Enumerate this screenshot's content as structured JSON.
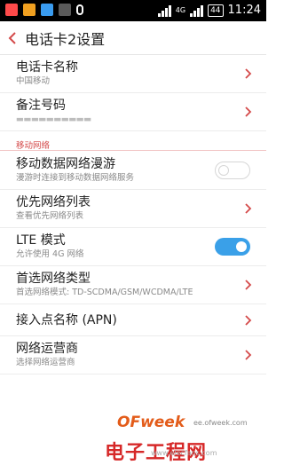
{
  "statusbar": {
    "network_label": "4G",
    "battery": "44",
    "time": "11:24"
  },
  "header": {
    "title": "电话卡2设置"
  },
  "rows": [
    {
      "main": "电话卡名称",
      "sub": "中国移动"
    },
    {
      "main": "备注号码",
      "sub": "▬▬▬▬▬▬▬▬▬▬"
    }
  ],
  "section": {
    "label": "移动网络"
  },
  "network_rows": [
    {
      "main": "移动数据网络漫游",
      "sub": "漫游时连接到移动数据网络服务",
      "toggle": "off"
    },
    {
      "main": "优先网络列表",
      "sub": "查看优先网络列表"
    },
    {
      "main": "LTE 模式",
      "sub": "允许使用 4G 网络",
      "toggle": "on"
    },
    {
      "main": "首选网络类型",
      "sub": "首选网络模式: TD-SCDMA/GSM/WCDMA/LTE"
    },
    {
      "main": "接入点名称 (APN)"
    },
    {
      "main": "网络运营商",
      "sub": "选择网络运营商"
    }
  ],
  "watermark": {
    "logo": "OFweek",
    "domain": "ee.ofweek.com",
    "big": "电子工程网",
    "faint": "www.elecfans.com"
  },
  "colors": {
    "accent_red": "#d44a4a",
    "toggle_on": "#3aa0e8"
  }
}
